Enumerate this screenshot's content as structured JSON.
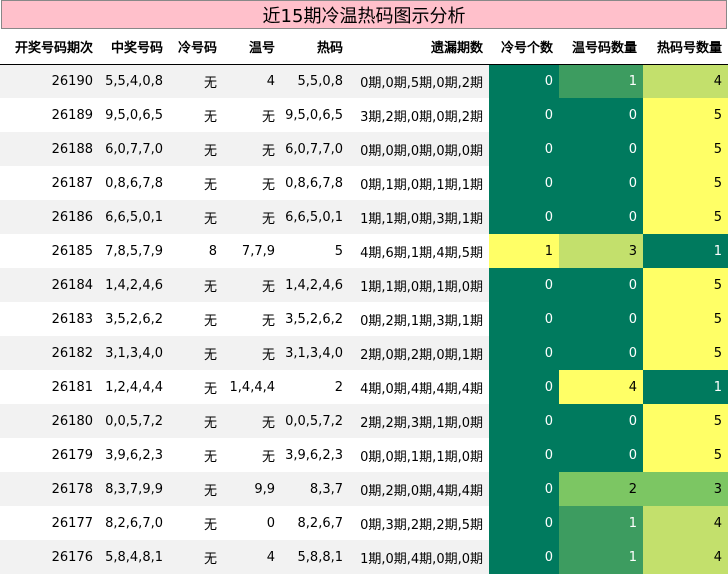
{
  "title": "近15期冷温热码图示分析",
  "headers": [
    "开奖号码期次",
    "中奖号码",
    "冷号码",
    "温号",
    "热码",
    "遗漏期数",
    "冷号个数",
    "温号码数量",
    "热码号数量"
  ],
  "rows": [
    [
      "26190",
      "5,5,4,0,8",
      "无",
      "4",
      "5,5,0,8",
      "0期,0期,5期,0期,2期",
      "0",
      "1",
      "4"
    ],
    [
      "26189",
      "9,5,0,6,5",
      "无",
      "无",
      "9,5,0,6,5",
      "3期,2期,0期,0期,2期",
      "0",
      "0",
      "5"
    ],
    [
      "26188",
      "6,0,7,7,0",
      "无",
      "无",
      "6,0,7,7,0",
      "0期,0期,0期,0期,0期",
      "0",
      "0",
      "5"
    ],
    [
      "26187",
      "0,8,6,7,8",
      "无",
      "无",
      "0,8,6,7,8",
      "0期,1期,0期,1期,1期",
      "0",
      "0",
      "5"
    ],
    [
      "26186",
      "6,6,5,0,1",
      "无",
      "无",
      "6,6,5,0,1",
      "1期,1期,0期,3期,1期",
      "0",
      "0",
      "5"
    ],
    [
      "26185",
      "7,8,5,7,9",
      "8",
      "7,7,9",
      "5",
      "4期,6期,1期,4期,5期",
      "1",
      "3",
      "1"
    ],
    [
      "26184",
      "1,4,2,4,6",
      "无",
      "无",
      "1,4,2,4,6",
      "1期,1期,0期,1期,0期",
      "0",
      "0",
      "5"
    ],
    [
      "26183",
      "3,5,2,6,2",
      "无",
      "无",
      "3,5,2,6,2",
      "0期,2期,1期,3期,1期",
      "0",
      "0",
      "5"
    ],
    [
      "26182",
      "3,1,3,4,0",
      "无",
      "无",
      "3,1,3,4,0",
      "2期,0期,2期,0期,1期",
      "0",
      "0",
      "5"
    ],
    [
      "26181",
      "1,2,4,4,4",
      "无",
      "1,4,4,4",
      "2",
      "4期,0期,4期,4期,4期",
      "0",
      "4",
      "1"
    ],
    [
      "26180",
      "0,0,5,7,2",
      "无",
      "无",
      "0,0,5,7,2",
      "2期,2期,3期,1期,0期",
      "0",
      "0",
      "5"
    ],
    [
      "26179",
      "3,9,6,2,3",
      "无",
      "无",
      "3,9,6,2,3",
      "0期,0期,1期,1期,0期",
      "0",
      "0",
      "5"
    ],
    [
      "26178",
      "8,3,7,9,9",
      "无",
      "9,9",
      "8,3,7",
      "0期,2期,0期,4期,4期",
      "0",
      "2",
      "3"
    ],
    [
      "26177",
      "8,2,6,7,0",
      "无",
      "0",
      "8,2,6,7",
      "0期,3期,2期,2期,5期",
      "0",
      "1",
      "4"
    ],
    [
      "26176",
      "5,8,4,8,1",
      "无",
      "4",
      "5,8,8,1",
      "1期,0期,4期,0期,0期",
      "0",
      "1",
      "4"
    ]
  ],
  "heat_colors": {
    "0": "#007a5e",
    "1": "#ffff66",
    "2": "#7cc663",
    "3": "#c3e06c",
    "4": "#ffff66",
    "5": "#ffff66"
  },
  "warm_colors": {
    "0": "#007a5e",
    "1": "#3d9c60",
    "2": "#7cc663",
    "3": "#c3e06c",
    "4": "#ffff66"
  },
  "hot_colors": {
    "1": "#007a5e",
    "3": "#7cc663",
    "4": "#c3e06c",
    "5": "#ffff66"
  }
}
